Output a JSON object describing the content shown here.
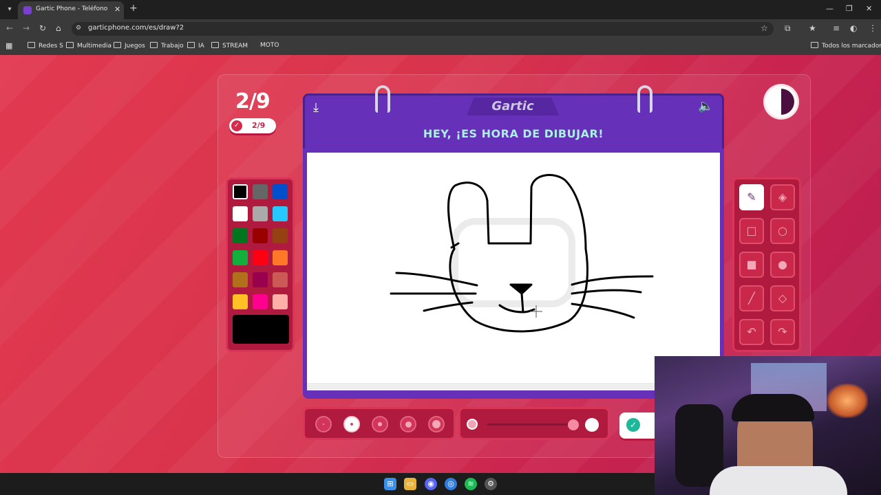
{
  "browser": {
    "tab_title": "Gartic Phone - Teléfono Descon",
    "new_tab": "+",
    "url": "garticphone.com/es/draw?2",
    "bookmarks": [
      "Redes S",
      "Multimedia",
      "Juegos",
      "Trabajo",
      "IA",
      "STREAM",
      "MOTO"
    ],
    "all_bookmarks": "Todos los marcadores",
    "window_controls": [
      "—",
      "❐",
      "✕"
    ]
  },
  "game": {
    "round_big": "2/9",
    "round_pill": "2/9",
    "logo": "Gartic",
    "prompt": "HEY, ¡ES HORA DE DIBUJAR!",
    "palette_colors": [
      "#000000",
      "#666666",
      "#0050cd",
      "#ffffff",
      "#aaaaaa",
      "#26c9ff",
      "#017420",
      "#990000",
      "#964112",
      "#11b03c",
      "#ff0013",
      "#ff7829",
      "#b0701c",
      "#99004e",
      "#cb5a57",
      "#ffc126",
      "#ff008f",
      "#feafa8"
    ],
    "current_color": "#000000",
    "tools": [
      "pencil-icon",
      "eraser-icon",
      "rectangle-outline-icon",
      "circle-outline-icon",
      "rectangle-filled-icon",
      "circle-filled-icon",
      "line-icon",
      "fill-bucket-icon",
      "undo-icon",
      "redo-icon"
    ],
    "brush_sizes_selected_index": 1
  }
}
